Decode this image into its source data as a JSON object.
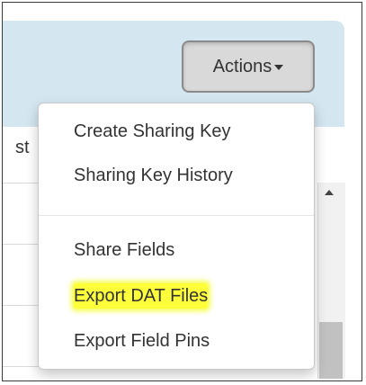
{
  "toolbar": {
    "actions_label": "Actions"
  },
  "table": {
    "column_header_fragment": "st"
  },
  "actions_menu": {
    "items": [
      {
        "label": "Create Sharing Key"
      },
      {
        "label": "Sharing Key History"
      },
      {
        "label": "Share Fields"
      },
      {
        "label": "Export DAT Files",
        "highlighted": true
      },
      {
        "label": "Export Field Pins"
      }
    ]
  },
  "colors": {
    "header_band": "#d4e7f1",
    "highlight": "#ffff3a",
    "button_bg": "#d9d9d9",
    "text": "#333333"
  },
  "icons": {
    "button_caret": "caret-down-icon",
    "scroll_up": "scroll-up-arrow-icon"
  }
}
